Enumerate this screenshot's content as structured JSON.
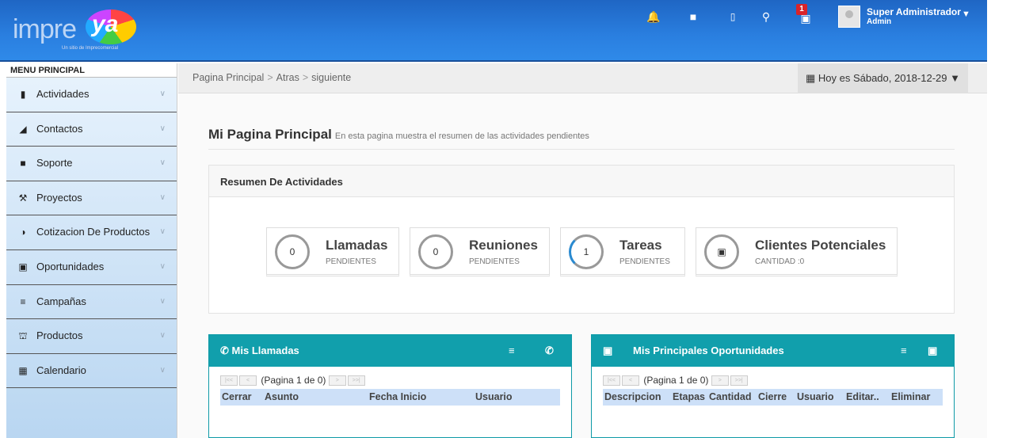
{
  "header": {
    "logo_word": "impre",
    "logo_ya": "ya",
    "logo_tagline": "Un sitio de Imprecomercial",
    "notification_count": "1",
    "user_name": "Super Administrador",
    "user_role": "Admin"
  },
  "sidebar": {
    "title": "MENU PRINCIPAL",
    "items": [
      {
        "label": "Actividades"
      },
      {
        "label": "Contactos"
      },
      {
        "label": "Soporte"
      },
      {
        "label": "Proyectos"
      },
      {
        "label": "Cotizacion De Productos"
      },
      {
        "label": "Oportunidades"
      },
      {
        "label": "Campañas"
      },
      {
        "label": "Productos"
      },
      {
        "label": "Calendario"
      }
    ]
  },
  "breadcrumb": {
    "items": [
      "Pagina Principal",
      "Atras",
      "siguiente"
    ],
    "date_text": "Hoy es Sábado, 2018-12-29"
  },
  "page": {
    "title": "Mi Pagina Principal",
    "subtitle": "En esta pagina muestra el resumen de las actividades pendientes"
  },
  "resumen": {
    "title": "Resumen De Actividades",
    "stats": [
      {
        "value": "0",
        "name": "Llamadas",
        "sub": "PENDIENTES"
      },
      {
        "value": "0",
        "name": "Reuniones",
        "sub": "PENDIENTES"
      },
      {
        "value": "1",
        "name": "Tareas",
        "sub": "PENDIENTES"
      },
      {
        "value": "",
        "name": "Clientes Potenciales",
        "sub": "CANTIDAD :0"
      }
    ]
  },
  "llamadas_panel": {
    "title": "Mis Llamadas",
    "pager": "(Pagina 1 de 0)",
    "columns": [
      "Cerrar",
      "Asunto",
      "Fecha Inicio",
      "Usuario"
    ]
  },
  "oportunidades_panel": {
    "title": "Mis Principales Oportunidades",
    "pager": "(Pagina 1 de 0)",
    "columns": [
      "Descripcion",
      "Etapas",
      "Cantidad",
      "Cierre",
      "Usuario",
      "Editar..",
      "Eliminar"
    ]
  },
  "colors": {
    "header_blue": "#2a7fe0",
    "panel_teal": "#119fac",
    "badge_red": "#d9232a"
  }
}
